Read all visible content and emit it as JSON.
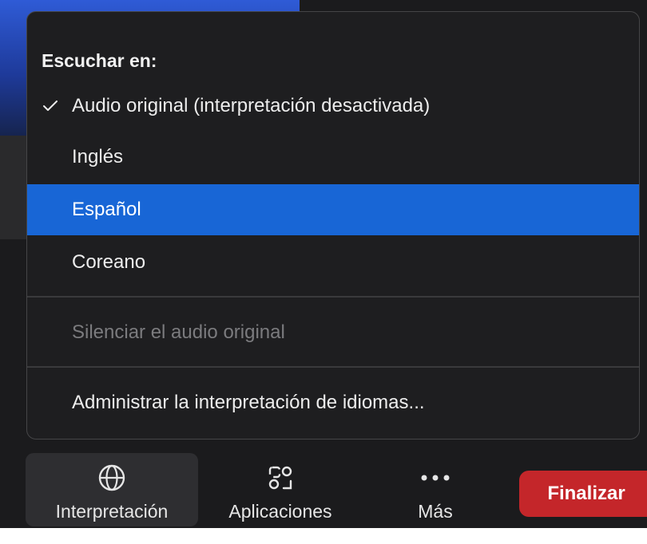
{
  "menu": {
    "header": "Escuchar en:",
    "items": [
      {
        "label": "Audio original (interpretación desactivada)",
        "checked": true
      },
      {
        "label": "Inglés"
      },
      {
        "label": "Español",
        "selected": true
      },
      {
        "label": "Coreano"
      }
    ],
    "mute_original": "Silenciar el audio original",
    "manage": "Administrar la interpretación de idiomas..."
  },
  "toolbar": {
    "interpretation": {
      "label": "Interpretación",
      "icon": "globe-icon"
    },
    "apps": {
      "label": "Aplicaciones",
      "icon": "apps-icon"
    },
    "more": {
      "label": "Más",
      "icon": "more-icon"
    },
    "end": "Finalizar"
  },
  "colors": {
    "selected": "#1866d6",
    "end_button": "#c4262a",
    "menu_bg": "#1e1e20"
  }
}
